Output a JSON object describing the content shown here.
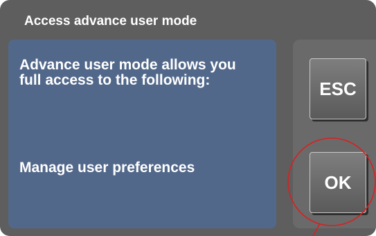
{
  "dialog": {
    "title": "Access advance user mode",
    "description": "Advance user mode allows you full access to the following:",
    "item": "Manage user preferences"
  },
  "buttons": {
    "esc_label": "ESC",
    "ok_label": "OK"
  },
  "colors": {
    "panel": "#5e5e5e",
    "content": "#52688a",
    "highlight_circle": "#d92020"
  }
}
